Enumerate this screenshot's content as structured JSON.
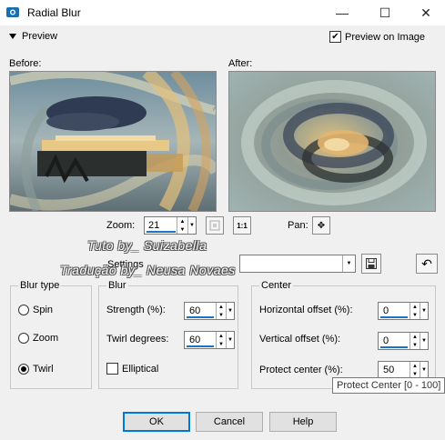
{
  "window": {
    "title": "Radial Blur",
    "minimize": "—",
    "maximize": "☐",
    "close": "✕"
  },
  "preview": {
    "toggle_label": "Preview",
    "preview_on_image_label": "Preview on Image",
    "preview_on_image_checked": true
  },
  "images": {
    "before_label": "Before:",
    "after_label": "After:"
  },
  "zoom": {
    "label": "Zoom:",
    "value": "21",
    "pan_label": "Pan:",
    "one_to_one": "1:1"
  },
  "settings": {
    "label": "Settings",
    "value": ""
  },
  "watermark": {
    "line1": "Tuto by_ Suizabella",
    "line2": "Tradução by_ Neusa Novaes"
  },
  "blur_type": {
    "title": "Blur type",
    "options": [
      {
        "label": "Spin",
        "selected": false
      },
      {
        "label": "Zoom",
        "selected": false
      },
      {
        "label": "Twirl",
        "selected": true
      }
    ]
  },
  "blur": {
    "title": "Blur",
    "strength_label": "Strength (%):",
    "strength_value": "60",
    "twirl_label": "Twirl degrees:",
    "twirl_value": "60",
    "elliptical_label": "Elliptical",
    "elliptical_checked": false
  },
  "center": {
    "title": "Center",
    "horizontal_label": "Horizontal offset (%):",
    "horizontal_value": "0",
    "vertical_label": "Vertical offset (%):",
    "vertical_value": "0",
    "protect_label": "Protect center (%):",
    "protect_value": "50"
  },
  "tooltip": {
    "text": "Protect Center [0 - 100]"
  },
  "buttons": {
    "ok": "OK",
    "cancel": "Cancel",
    "help": "Help"
  },
  "colors": {
    "accent": "#1c72c8",
    "default_button_border": "#0078d7"
  }
}
